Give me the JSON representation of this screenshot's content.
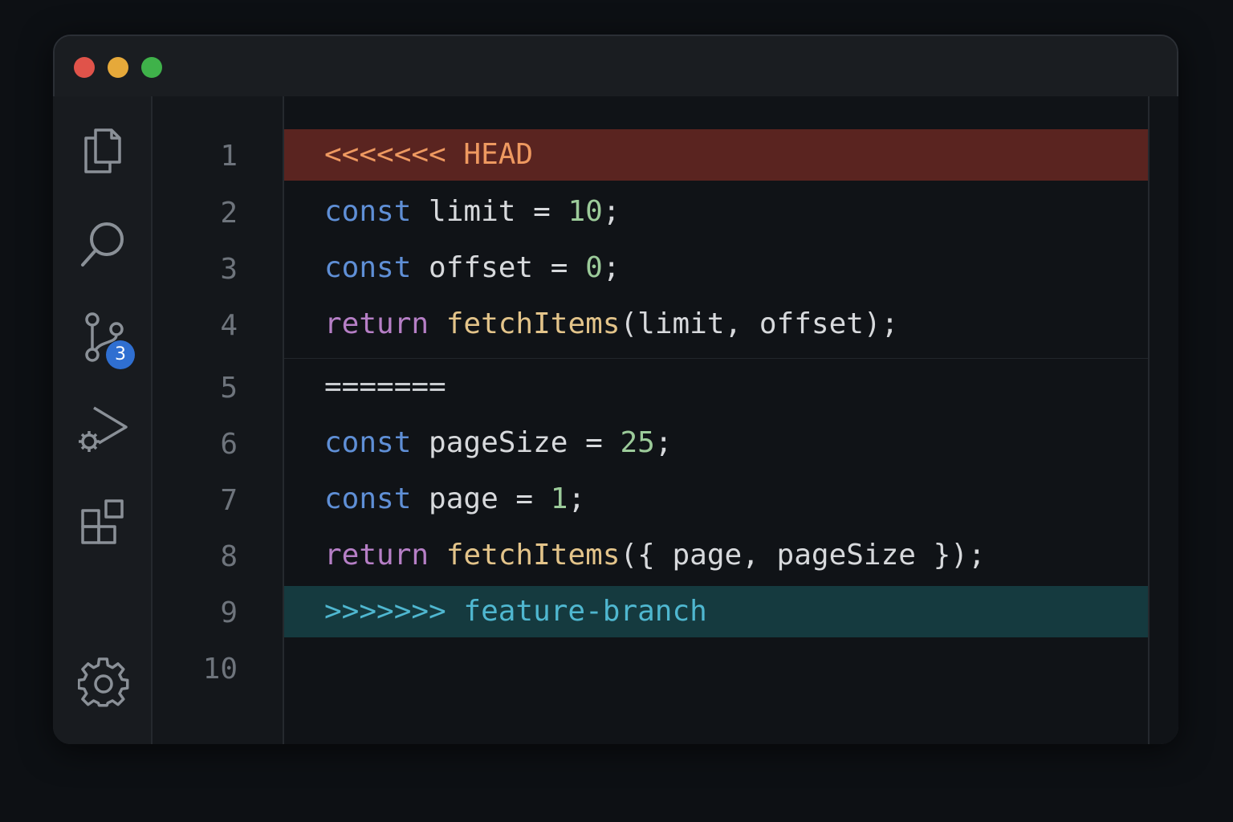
{
  "window": {
    "traffic_lights": {
      "close_color": "#e0534a",
      "minimize_color": "#e6a93a",
      "maximize_color": "#3fb24a"
    }
  },
  "activity_bar": {
    "items": [
      {
        "icon": "files-icon"
      },
      {
        "icon": "search-icon"
      },
      {
        "icon": "source-control-icon",
        "badge": "3"
      },
      {
        "icon": "run-debug-icon"
      },
      {
        "icon": "extensions-icon"
      }
    ],
    "settings_icon": "gear-icon",
    "badge_color": "#2f6fd1"
  },
  "editor": {
    "line_numbers": [
      "1",
      "2",
      "3",
      "4",
      "5",
      "6",
      "7",
      "8",
      "9",
      "10"
    ],
    "conflict": {
      "current_marker": "<<<<<<< HEAD",
      "current_color": "#5a2420",
      "separator": "=======",
      "incoming_marker": ">>>>>>> feature-branch",
      "incoming_color": "#153a3f"
    },
    "lines": {
      "l2": {
        "kw": "const",
        "a": " limit = ",
        "num": "10",
        "b": ";"
      },
      "l3": {
        "kw": "const",
        "a": " offset = ",
        "num": "0",
        "b": ";"
      },
      "l4": {
        "kw": "return",
        "a": " ",
        "fn": "fetchItems",
        "b": "(limit, offset);"
      },
      "l6": {
        "kw": "const",
        "a": " pageSize = ",
        "num": "25",
        "b": ";"
      },
      "l7": {
        "kw": "const",
        "a": " page = ",
        "num": "1",
        "b": ";"
      },
      "l8": {
        "kw": "return",
        "a": " ",
        "fn": "fetchItems",
        "b": "({ page, pageSize });"
      }
    }
  }
}
